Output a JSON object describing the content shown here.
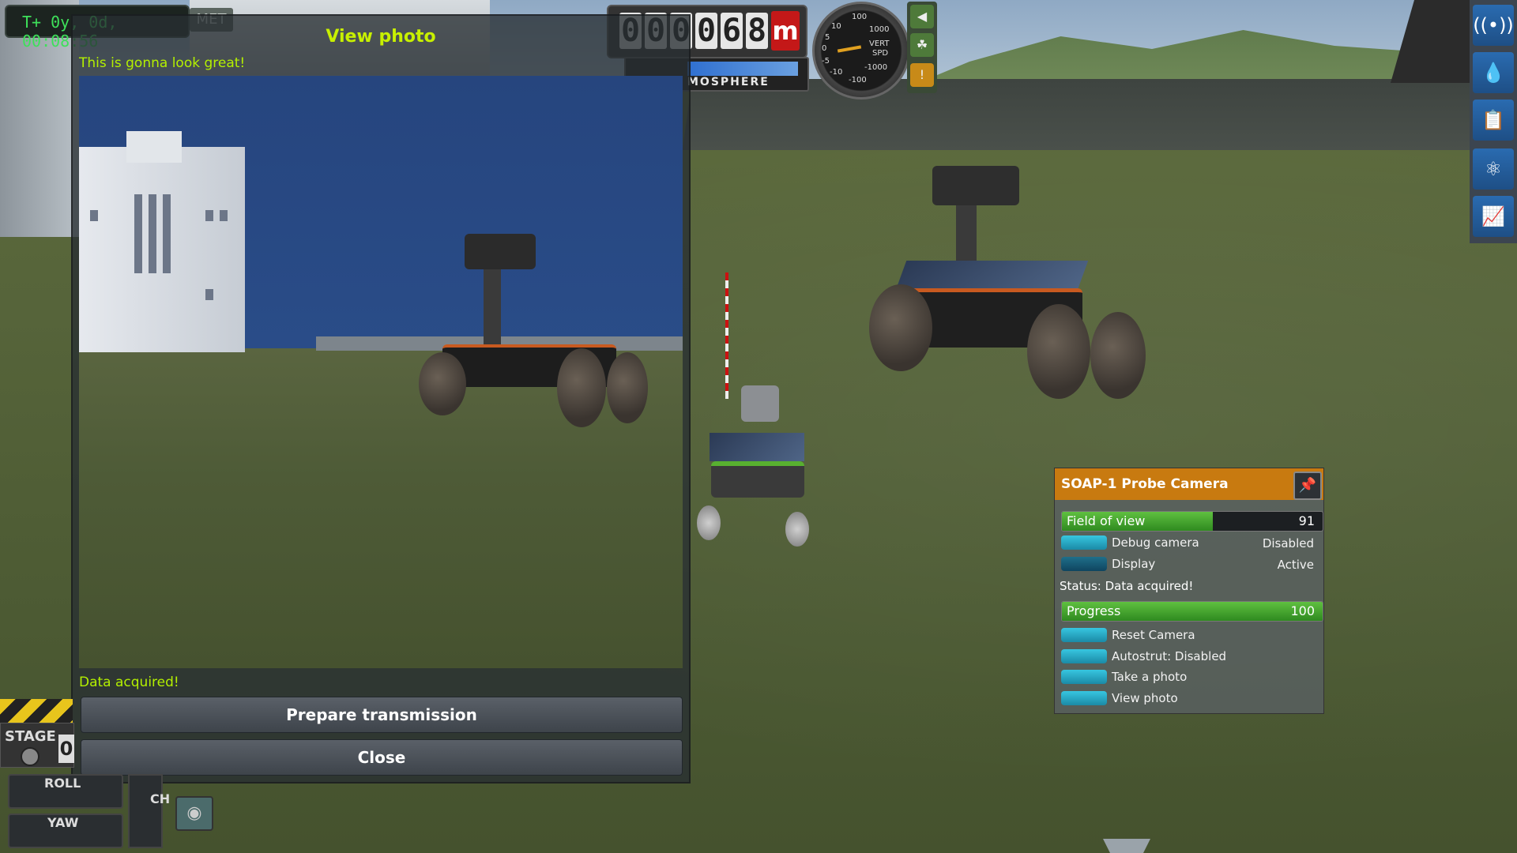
{
  "hud": {
    "met_value": "T+ 0y, 0d, 00:08:56",
    "met_tag": "MET",
    "altitude_digits": [
      "0",
      "0",
      "0",
      "0",
      "6",
      "8"
    ],
    "altitude_unit": "m",
    "atmosphere_label": "MOSPHERE",
    "speed_labels": {
      "top": "100",
      "r1": "1000",
      "vert": "VERT",
      "spd": "SPD",
      "l1": "10",
      "l2": "5",
      "zero": "0",
      "m5": "-5",
      "m10": "-10",
      "m1000": "-1000",
      "m100": "-100"
    }
  },
  "toolbar": {
    "buttons": [
      {
        "icon": "antenna-signal-icon",
        "glyph": "((•))"
      },
      {
        "icon": "fuel-drop-icon",
        "glyph": "💧"
      },
      {
        "icon": "contracts-clipboard-icon",
        "glyph": "📋"
      },
      {
        "icon": "science-icon",
        "glyph": "⚛"
      },
      {
        "icon": "kerbnet-icon",
        "glyph": "📈"
      }
    ]
  },
  "dialog": {
    "title": "View photo",
    "subtitle": "This is gonna look great!",
    "status": "Data acquired!",
    "prepare_button": "Prepare transmission",
    "close_button": "Close"
  },
  "stage": {
    "label": "STAGE",
    "count": "0",
    "roll_label": "ROLL",
    "yaw_label": "YAW",
    "pitch_label": "CH"
  },
  "part_menu": {
    "title": "SOAP-1 Probe Camera",
    "field_of_view": {
      "label": "Field of view",
      "value": "91",
      "fraction": 0.58
    },
    "rows_top": [
      {
        "label": "Debug camera",
        "value": "Disabled"
      },
      {
        "label": "Display",
        "value": "Active"
      }
    ],
    "status": "Status: Data acquired!",
    "progress": {
      "label": "Progress",
      "value": "100",
      "fraction": 1.0
    },
    "actions": [
      {
        "label": "Reset Camera"
      },
      {
        "label": "Autostrut: Disabled"
      },
      {
        "label": "Take a photo"
      },
      {
        "label": "View photo"
      }
    ]
  },
  "colors": {
    "accent_orange": "#c87a10",
    "toggle_cyan": "#37c6e0",
    "status_green": "#b4f000",
    "met_green": "#3ee05a"
  }
}
